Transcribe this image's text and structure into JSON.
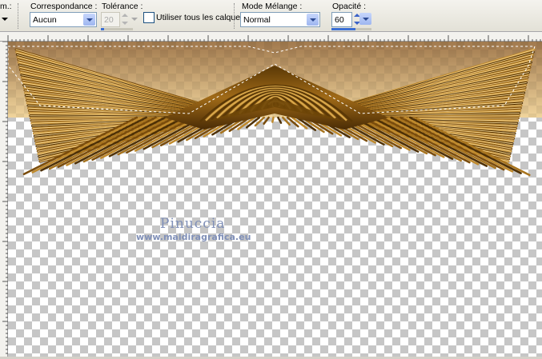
{
  "toolbar": {
    "partial_label": "m.:",
    "match": {
      "label": "Correspondance :",
      "value": "Aucun"
    },
    "tolerance": {
      "label": "Tolérance :",
      "value": "20",
      "level_percent": 10
    },
    "all_layers": {
      "label": "Utiliser tous les calques",
      "checked": false
    },
    "blend": {
      "label": "Mode Mélange :",
      "value": "Normal"
    },
    "opacity": {
      "label": "Opacité :",
      "value": "60",
      "level_percent": 60
    }
  },
  "canvas": {
    "watermark_title": "Pinuccia",
    "watermark_url": "www.maidiragrafica.eu"
  },
  "colors": {
    "wood": "#8a5a12",
    "wood_dark": "#4a2c05",
    "sky_top": "#a27a4e",
    "sky_bottom": "#f0d49c",
    "accent": "#3b6fd4"
  },
  "icons": [
    "dropdown-arrow-icon",
    "spin-up-icon",
    "spin-down-icon",
    "checkbox-icon"
  ]
}
